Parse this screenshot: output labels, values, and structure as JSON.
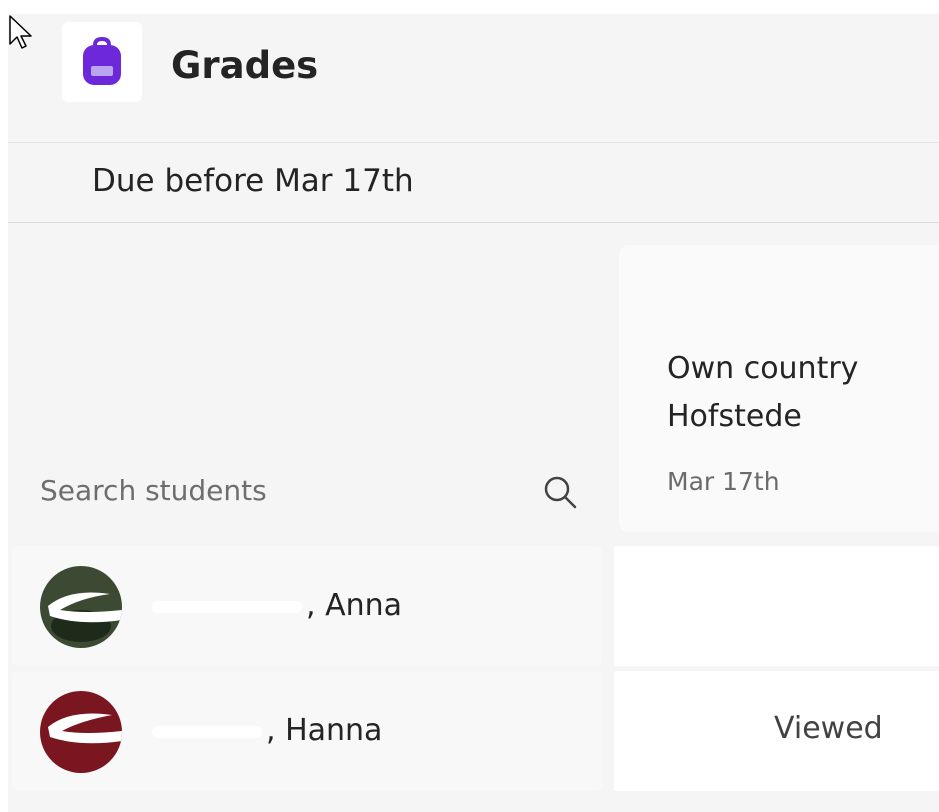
{
  "app": {
    "title": "Grades",
    "icon": "backpack-icon",
    "accent": "#6d28d9"
  },
  "filter": {
    "due_label": "Due before Mar 17th"
  },
  "search": {
    "placeholder": "Search students",
    "icon": "search-icon"
  },
  "assignment": {
    "title": "Own country Hofstede",
    "date": "Mar 17th"
  },
  "students": [
    {
      "name": "Anna",
      "status": ""
    },
    {
      "name": "Hanna",
      "status": "Viewed"
    }
  ]
}
